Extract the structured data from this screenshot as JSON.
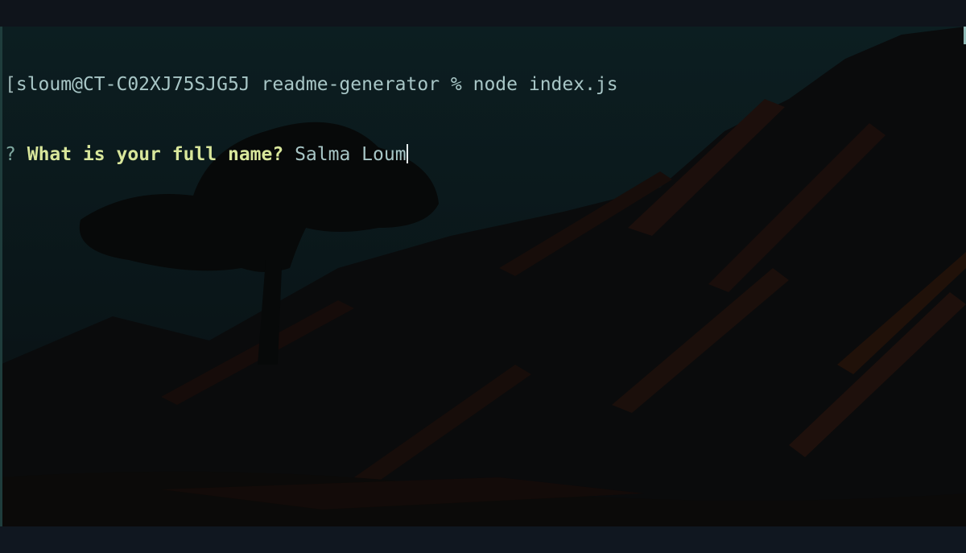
{
  "terminal": {
    "command_line": {
      "prompt": "sloum@CT-C02XJ75SJG5J readme-generator %",
      "command": "node index.js"
    },
    "question_line": {
      "marker": "?",
      "question": "What is your full name?",
      "answer": "Salma Loum"
    }
  },
  "colors": {
    "background": "#0b1a1c",
    "question_text": "#d8e69b",
    "body_text": "#a8c6c6"
  }
}
